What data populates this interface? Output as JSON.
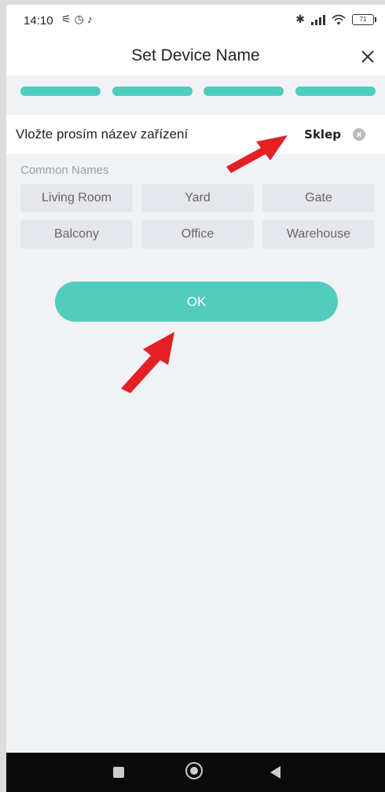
{
  "status_bar": {
    "time": "14:10",
    "left_icons": [
      "muted-icon",
      "alarm-icon",
      "tiktok-icon"
    ],
    "right_icons": [
      "bluetooth-icon",
      "signal-icon",
      "wifi-icon",
      "battery-icon"
    ],
    "battery": "71"
  },
  "header": {
    "title": "Set Device Name",
    "close_icon": "close-icon"
  },
  "progress": {
    "steps_total": 4,
    "steps_completed": 4,
    "color": "#4ecdbd"
  },
  "name_field": {
    "label": "Vložte prosím název zařízení",
    "value": "Sklep",
    "clear_icon": "clear-circle-icon"
  },
  "common_names": {
    "title": "Common Names",
    "items": [
      "Living Room",
      "Yard",
      "Gate",
      "Balcony",
      "Office",
      "Warehouse"
    ]
  },
  "ok_button": {
    "label": "OK",
    "color": "#52cdbd"
  },
  "annotation_color": "#e32024",
  "nav_bar": {
    "icons": [
      "recent-apps-icon",
      "home-icon",
      "back-icon"
    ]
  }
}
